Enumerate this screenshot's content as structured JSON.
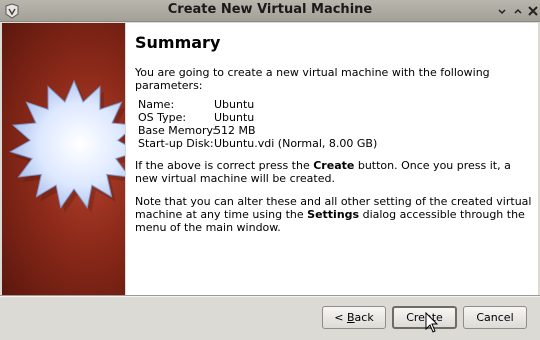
{
  "window": {
    "title": "Create New Virtual Machine"
  },
  "summary": {
    "heading": "Summary",
    "intro": "You are going to create a new virtual machine with the following parameters:",
    "params": [
      {
        "label": "Name:",
        "value": "Ubuntu"
      },
      {
        "label": "OS Type:",
        "value": "Ubuntu"
      },
      {
        "label": "Base Memory:",
        "value": "512 MB"
      },
      {
        "label": "Start-up Disk:",
        "value": "Ubuntu.vdi (Normal, 8.00 GB)"
      }
    ],
    "para1_a": "If the above is correct press the ",
    "para1_b": "Create",
    "para1_c": " button. Once you press it, a new virtual machine will be created.",
    "para2_a": "Note that you can alter these and all other setting of the created virtual machine at any time using the ",
    "para2_b": "Settings",
    "para2_c": " dialog accessible through the menu of the main window."
  },
  "buttons": {
    "back_prefix": "< ",
    "back_mnemonic": "B",
    "back_rest": "ack",
    "create_label": "Create",
    "cancel_label": "Cancel"
  },
  "icons": {
    "app": "virtualbox-icon",
    "minimize": "minimize-icon",
    "maximize": "maximize-icon",
    "close": "close-icon",
    "banner": "starburst-graphic",
    "cursor": "mouse-pointer"
  },
  "colors": {
    "banner_red": "#8d2a1a",
    "star": "#cfe0ff"
  }
}
